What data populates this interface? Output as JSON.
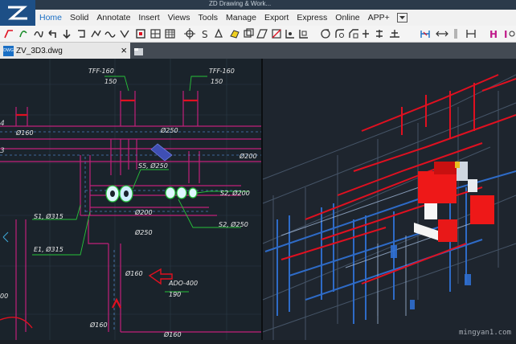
{
  "app": {
    "title_fragment": "ZD Drawing & Work..."
  },
  "menu": {
    "items": [
      "Home",
      "Solid",
      "Annotate",
      "Insert",
      "Views",
      "Tools",
      "Manage",
      "Export",
      "Express",
      "Online",
      "APP+"
    ]
  },
  "document": {
    "tab_label": "ZV_3D3.dwg",
    "close_glyph": "×",
    "dwg_badge": "DWG"
  },
  "drawing_labels": {
    "tff_left_name": "TFF-160",
    "tff_left_value": "150",
    "tff_right_name": "TFF-160",
    "tff_right_value": "150",
    "d160_top": "Ø160",
    "d250_top": "Ø250",
    "d200_right": "Ø200",
    "s5": "S5, Ø250",
    "s2_upper": "S2, Ø200",
    "s1": "S1, Ø315",
    "d200_center": "Ø200",
    "s2_lower": "S2, Ø250",
    "d250_center": "Ø250",
    "e1": "E1, Ø315",
    "d160_lower": "Ø160",
    "ado_name": "ADO-400",
    "ado_value": "190",
    "d160_bottom": "Ø160",
    "d160_bottom2": "Ø160",
    "left_edge_value": "00"
  },
  "watermark": "mingyan1.com",
  "colors": {
    "menu_active": "#1a6fc5",
    "duct_magenta": "#c0207a",
    "duct_red": "#e01020",
    "leader_green": "#27c23a",
    "drawing_bg": "#1b2026"
  }
}
